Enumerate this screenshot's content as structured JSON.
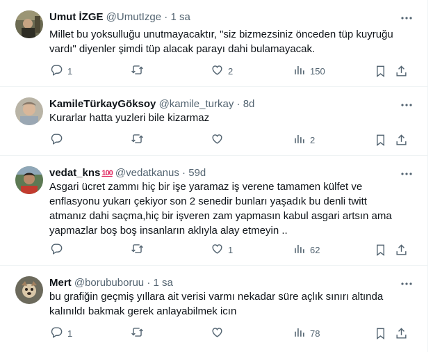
{
  "tweets": [
    {
      "name": "Umut İZGE",
      "handle": "@UmutIzge",
      "time": "1 sa",
      "text": "Millet bu yoksulluğu unutmayacaktır, \"siz bizmezsiniz önceden tüp kuyruğu\nvardı\" diyenler şimdi tüp alacak parayı dahi bulamayacak.",
      "replies": "1",
      "retweets": "",
      "likes": "2",
      "views": "150"
    },
    {
      "name": "KamileTürkayGöksoy",
      "handle": "@kamile_turkay",
      "time": "8d",
      "text": "Kurarlar hatta yuzleri bile kizarmaz",
      "replies": "",
      "retweets": "",
      "likes": "",
      "views": "2"
    },
    {
      "name": "vedat_kns",
      "emoji": "100",
      "handle": "@vedatkanus",
      "time": "59d",
      "text": "Asgari ücret zammı hiç bir işe yaramaz iş verene tamamen külfet ve\nenflasyonu yukarı çekiyor son 2 senedir bunları yaşadık bu denli twitt\natmanız dahi saçma,hiç bir işveren zam yapmasın kabul asgari artsın ama\nyapmazlar boş boş insanların aklıyla alay etmeyin ..",
      "replies": "",
      "retweets": "",
      "likes": "1",
      "views": "62"
    },
    {
      "name": "Mert",
      "handle": "@borububoruu",
      "time": "1 sa",
      "text": "bu grafiğin geçmiş yıllara ait verisi varmı nekadar süre açlık sınırı altında\nkalınıldı bakmak gerek anlayabilmek icın",
      "replies": "1",
      "retweets": "",
      "likes": "",
      "views": "78"
    }
  ],
  "colors": {
    "text": "#0f1419",
    "secondary": "#536471",
    "divider": "#eff3f4"
  },
  "icons": [
    "reply-icon",
    "retweet-icon",
    "like-icon",
    "views-icon",
    "bookmark-icon",
    "share-icon",
    "more-icon"
  ]
}
